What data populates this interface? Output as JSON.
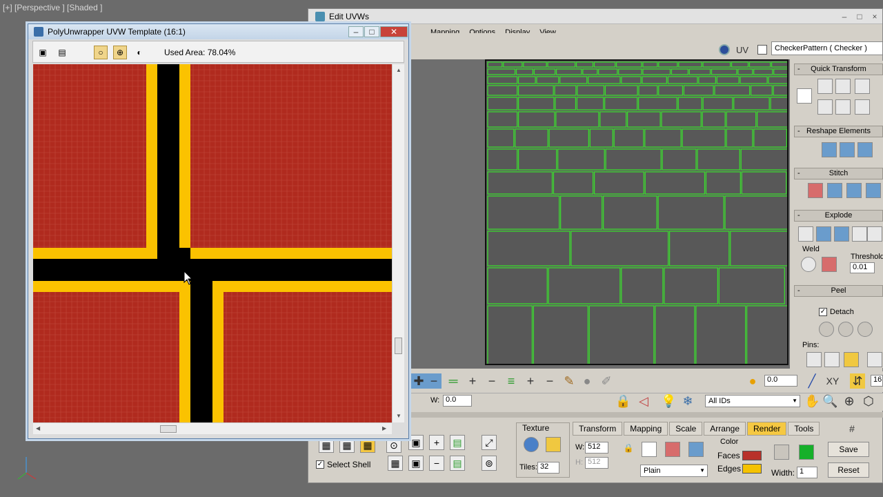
{
  "viewport": {
    "label": "[+] [Perspective ] [Shaded ]"
  },
  "edit_uvws": {
    "title": "Edit UVWs",
    "window_controls": [
      "–",
      "□",
      "×"
    ],
    "menu": [
      "Mapping",
      "Options",
      "Display",
      "View"
    ],
    "uv_label": "UV",
    "checker": "CheckerPattern  ( Checker )",
    "rollouts": {
      "quick_transform": "Quick Transform",
      "reshape_elements": "Reshape Elements",
      "stitch": "Stitch",
      "explode": "Explode",
      "weld": "Weld",
      "threshold_label": "Threshold",
      "threshold_value": "0.01",
      "peel": "Peel",
      "detach": "Detach",
      "pins": "Pins:"
    },
    "tools": {
      "value_field": "0.0",
      "xy_label": "XY",
      "zoom_field": "16",
      "w_label": "W:",
      "w_value": "0.0",
      "ids_select": "All IDs"
    },
    "bottom": {
      "texture_label": "Texture",
      "tiles_label": "Tiles:",
      "tiles_value": "32",
      "tabs": [
        "Transform",
        "Mapping",
        "Scale",
        "Arrange",
        "Render",
        "Tools"
      ],
      "active_tab": "Render",
      "w_label": "W:",
      "w_value": "512",
      "h_label": "H:",
      "h_value": "512",
      "fill_select": "Plain",
      "color_label": "Color",
      "faces_label": "Faces",
      "faces_color": "#b8312a",
      "edges_label": "Edges",
      "edges_color": "#f5c200",
      "width_label": "Width:",
      "width_value": "1",
      "save": "Save",
      "reset": "Reset",
      "select_shell": "Select Shell"
    }
  },
  "poly": {
    "title": "PolyUnwrapper UVW Template (16:1)",
    "used_area": "Used Area: 78.04%",
    "colors": {
      "face": "#b02a1e",
      "edge": "#fbc200",
      "background": "#000000"
    }
  }
}
